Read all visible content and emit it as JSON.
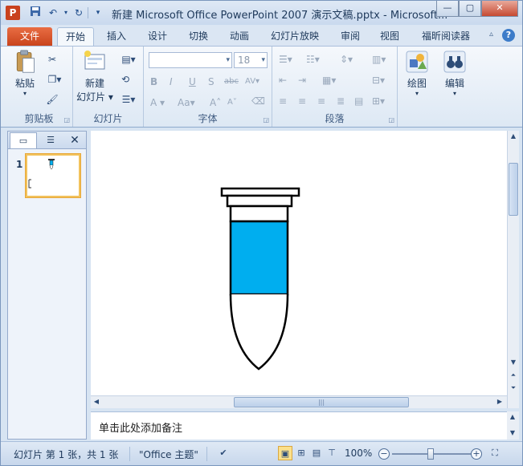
{
  "window": {
    "title": "新建 Microsoft Office PowerPoint 2007 演示文稿.pptx - Microsoft...",
    "app_icon": "P"
  },
  "qat": {
    "save": "save-icon",
    "undo": "undo-icon",
    "redo": "redo-icon"
  },
  "tabs": [
    {
      "label": "文件"
    },
    {
      "label": "开始"
    },
    {
      "label": "插入"
    },
    {
      "label": "设计"
    },
    {
      "label": "切换"
    },
    {
      "label": "动画"
    },
    {
      "label": "幻灯片放映"
    },
    {
      "label": "审阅"
    },
    {
      "label": "视图"
    },
    {
      "label": "福昕阅读器"
    }
  ],
  "ribbon": {
    "clipboard": {
      "label": "剪贴板",
      "paste": "粘贴"
    },
    "slides": {
      "label": "幻灯片",
      "new_slide_line1": "新建",
      "new_slide_line2": "幻灯片"
    },
    "font": {
      "label": "字体",
      "font_name": "",
      "font_size": "18"
    },
    "paragraph": {
      "label": "段落"
    },
    "drawing": {
      "label": "绘图"
    },
    "editing": {
      "label": "编辑"
    }
  },
  "left_panel": {
    "slide_number": "1"
  },
  "notes": {
    "placeholder": "单击此处添加备注"
  },
  "status": {
    "slide_info": "幻灯片 第 1 张，共 1 张",
    "theme": "\"Office 主题\"",
    "zoom": "100%"
  },
  "colors": {
    "tube_fill": "#00aeef",
    "file_tab": "#d9542b"
  }
}
